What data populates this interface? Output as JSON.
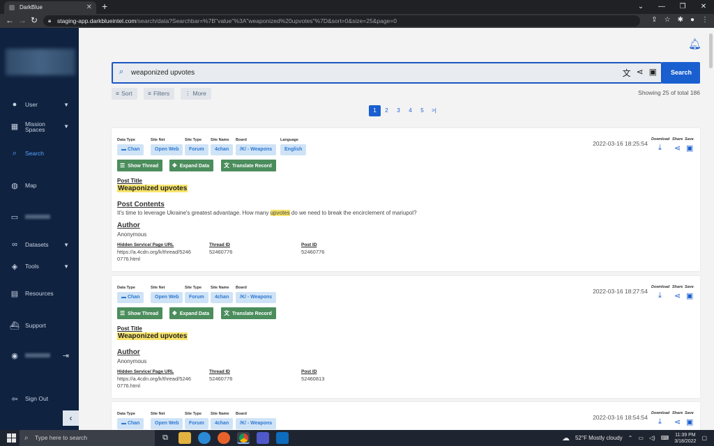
{
  "browser": {
    "tab_title": "DarkBlue",
    "url_host": "staging-app.darkblueintel.com",
    "url_path": "/search/data?Searchbar=%7B\"value\"%3A\"weaponized%20upvotes\"%7D&sort=0&size=25&page=0"
  },
  "sidebar": {
    "items": [
      {
        "label": "User",
        "icon": "user-icon"
      },
      {
        "label": "Mission Spaces",
        "icon": "grid-icon"
      },
      {
        "label": "Search",
        "icon": "search-icon"
      },
      {
        "label": "Map",
        "icon": "globe-icon"
      },
      {
        "label": "Datasets",
        "icon": "infinity-icon"
      },
      {
        "label": "Tools",
        "icon": "layers-icon"
      },
      {
        "label": "Resources",
        "icon": "book-icon"
      },
      {
        "label": "Support",
        "icon": "ship-icon"
      },
      {
        "label": "Sign Out",
        "icon": "sign-out-icon"
      }
    ],
    "accent_color": "#5aa2ff",
    "bg_color": "#0f2240"
  },
  "search": {
    "value": "weaponized upvotes",
    "button_label": "Search",
    "sort_label": "Sort",
    "filters_label": "Filters",
    "more_label": "More",
    "showing_text": "Showing 25 of total 186"
  },
  "pagination": {
    "pages": [
      "1",
      "2",
      "3",
      "4",
      "5"
    ],
    "current": "1",
    "last_label": ">|"
  },
  "labels": {
    "data_type": "Data Type",
    "site_net": "Site Net",
    "site_type": "Site Type",
    "site_name": "Site Name",
    "board": "Board",
    "language": "Language",
    "show_thread": "Show Thread",
    "expand_data": "Expand Data",
    "translate_record": "Translate Record",
    "download": "Download",
    "share": "Share",
    "save": "Save",
    "post_title": "Post Title",
    "post_contents": "Post Contents",
    "author": "Author",
    "hidden_service_url": "Hidden Service/ Page URL",
    "thread_id": "Thread ID",
    "post_id": "Post ID"
  },
  "results": [
    {
      "data_type": "Chan",
      "site_net": "Open Web",
      "site_type": "Forum",
      "site_name": "4chan",
      "board": "/K/ - Weapons",
      "language": "English",
      "date": "2022-03-16 18:25:54",
      "post_title": "Weaponized upvotes",
      "contents_pre": "It's time to leverage Ukraine's greatest advantage. How many ",
      "contents_hl": "upvotes",
      "contents_post": " do we need to break the encirclement of mariupol?",
      "author": "Anonymous",
      "url_line1": "https://a.4cdn.org/k/thread/5246",
      "url_line2": "0776.html",
      "thread_id": "52460776",
      "post_id": "52460776"
    },
    {
      "data_type": "Chan",
      "site_net": "Open Web",
      "site_type": "Forum",
      "site_name": "4chan",
      "board": "/K/ - Weapons",
      "date": "2022-03-16 18:27:54",
      "post_title": "Weaponized upvotes",
      "author": "Anonymous",
      "url_line1": "https://a.4cdn.org/k/thread/5246",
      "url_line2": "0776.html",
      "thread_id": "52460776",
      "post_id": "52460813"
    },
    {
      "data_type": "Chan",
      "site_net": "Open Web",
      "site_type": "Forum",
      "site_name": "4chan",
      "board": "/K/ - Weapons",
      "date": "2022-03-16 18:54:54"
    }
  ],
  "taskbar": {
    "search_placeholder": "Type here to search",
    "weather": "52°F  Mostly cloudy",
    "time": "11:39 PM",
    "date": "3/18/2022"
  }
}
